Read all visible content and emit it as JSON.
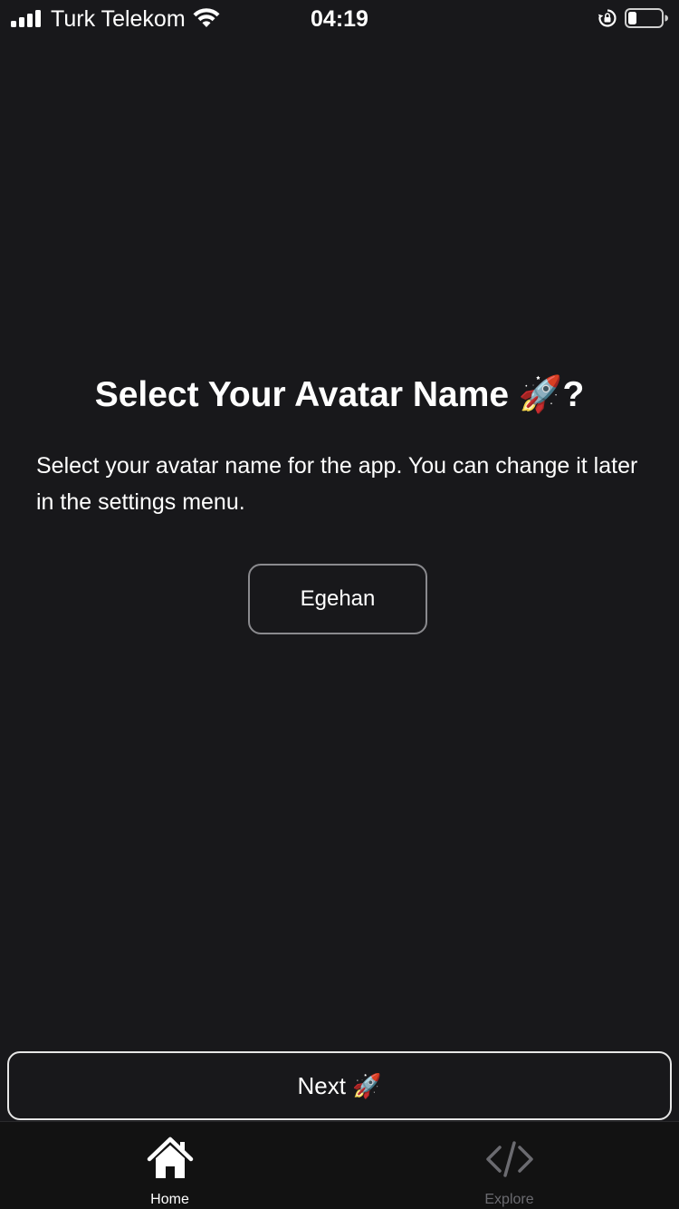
{
  "status_bar": {
    "carrier": "Turk Telekom",
    "time": "04:19",
    "icons": [
      "signal-icon",
      "wifi-icon",
      "rotation-lock-icon",
      "battery-icon"
    ]
  },
  "main": {
    "title": "Select Your Avatar Name 🚀?",
    "description": "Select your avatar name for the app. You can change it later in the settings menu.",
    "avatar_name_value": "Egehan"
  },
  "actions": {
    "next_label": "Next 🚀"
  },
  "tab_bar": {
    "tabs": [
      {
        "label": "Home",
        "icon": "home-icon",
        "active": true
      },
      {
        "label": "Explore",
        "icon": "code-icon",
        "active": false
      }
    ]
  },
  "colors": {
    "background": "#18181b",
    "tab_bar_background": "#121212",
    "text": "#ffffff",
    "inactive_tab": "#6b6b70",
    "input_border": "#8a8a8e"
  }
}
